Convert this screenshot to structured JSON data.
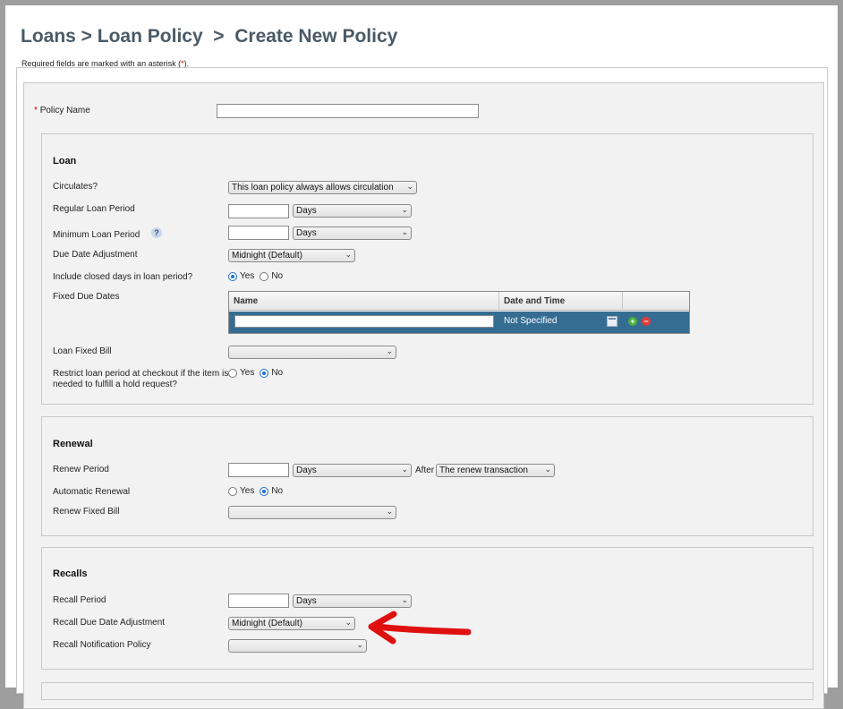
{
  "header": {
    "breadcrumb": "Loans > Loan Policy  >  Create New Policy",
    "required_note_prefix": "Required fields are marked with an asterisk (",
    "required_star": "*",
    "required_note_suffix": ")."
  },
  "policy_name": {
    "star": "*",
    "label": "Policy Name",
    "value": ""
  },
  "loan": {
    "title": "Loan",
    "circulates_label": "Circulates?",
    "circulates_value": "This loan policy always allows circulation",
    "regular_period_label": "Regular Loan Period",
    "regular_period_unit": "Days",
    "minimum_period_label": "Minimum Loan Period",
    "help_glyph": "?",
    "minimum_period_unit": "Days",
    "due_date_adj_label": "Due Date Adjustment",
    "due_date_adj_value": "Midnight (Default)",
    "include_closed_label": "Include closed days in loan period?",
    "include_closed_yes": "Yes",
    "include_closed_no": "No",
    "include_closed_selected": "Yes",
    "fixed_due_dates_label": "Fixed Due Dates",
    "fdd_col_name": "Name",
    "fdd_col_datetime": "Date and Time",
    "fdd_row_datetime": "Not Specified",
    "fixed_bill_label": "Loan Fixed Bill",
    "fixed_bill_value": "",
    "restrict_label": "Restrict loan period at checkout if the item is needed to fulfill a hold request?",
    "restrict_yes": "Yes",
    "restrict_no": "No",
    "restrict_selected": "No"
  },
  "renewal": {
    "title": "Renewal",
    "period_label": "Renew Period",
    "period_unit": "Days",
    "after_label": "After",
    "after_value": "The renew transaction",
    "auto_label": "Automatic Renewal",
    "auto_yes": "Yes",
    "auto_no": "No",
    "auto_selected": "No",
    "fixed_bill_label": "Renew Fixed Bill",
    "fixed_bill_value": ""
  },
  "recalls": {
    "title": "Recalls",
    "period_label": "Recall Period",
    "period_unit": "Days",
    "due_date_adj_label": "Recall Due Date Adjustment",
    "due_date_adj_value": "Midnight (Default)",
    "notification_label": "Recall Notification Policy",
    "notification_value": ""
  },
  "annotation": {
    "arrow_color": "#e01010"
  }
}
